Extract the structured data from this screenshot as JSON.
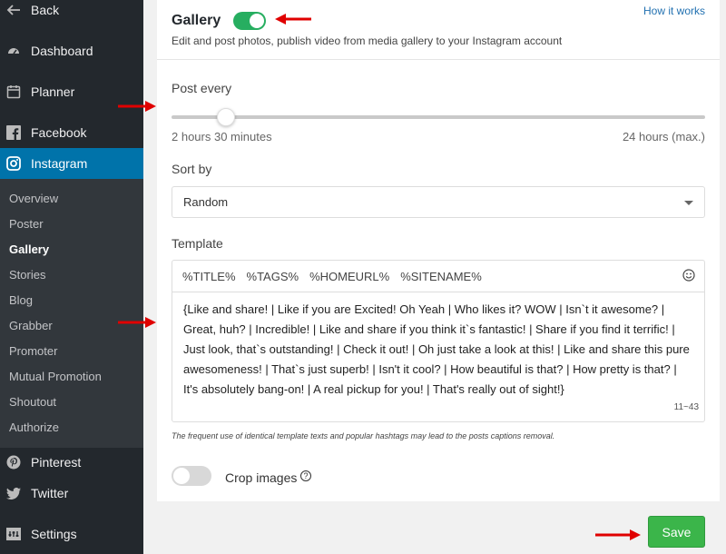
{
  "sidebar": {
    "back": "Back",
    "dashboard": "Dashboard",
    "planner": "Planner",
    "facebook": "Facebook",
    "instagram": "Instagram",
    "submenu": [
      "Overview",
      "Poster",
      "Gallery",
      "Stories",
      "Blog",
      "Grabber",
      "Promoter",
      "Mutual Promotion",
      "Shoutout",
      "Authorize"
    ],
    "pinterest": "Pinterest",
    "twitter": "Twitter",
    "settings": "Settings"
  },
  "header": {
    "title": "Gallery",
    "enabled": true,
    "how_it_works": "How it works",
    "description": "Edit and post photos, publish video from media gallery to your Instagram account"
  },
  "post_every": {
    "label": "Post every",
    "min_label": "2 hours 30 minutes",
    "max_label": "24 hours (max.)"
  },
  "sort_by": {
    "label": "Sort by",
    "value": "Random"
  },
  "template": {
    "label": "Template",
    "tags": [
      "%TITLE%",
      "%TAGS%",
      "%HOMEURL%",
      "%SITENAME%"
    ],
    "text": "{Like and share! | Like if you are Excited! Oh Yeah | Who likes it? WOW | Isn`t it awesome? | Great, huh? | Incredible! | Like and share if you think it`s fantastic! | Share if you find it terrific! | Just look, that`s outstanding! | Check it out! | Oh just take a look at this! | Like and share this pure awesomeness! | That`s just superb! | Isn't it cool? | How beautiful is that? | How pretty is that? | It's absolutely bang-on! | A real pickup for you! | That's really out of sight!}",
    "counter": "11~43",
    "note": "The frequent use of identical template texts and popular hashtags may lead to the posts captions removal."
  },
  "crop_images": {
    "label": "Crop images",
    "enabled": false,
    "help": "?"
  },
  "save_label": "Save",
  "colors": {
    "sidebar_bg": "#23282d",
    "active_item": "#0073aa",
    "toggle_on": "#27ae60",
    "save_button": "#3bb54a",
    "arrow": "#e00000"
  }
}
